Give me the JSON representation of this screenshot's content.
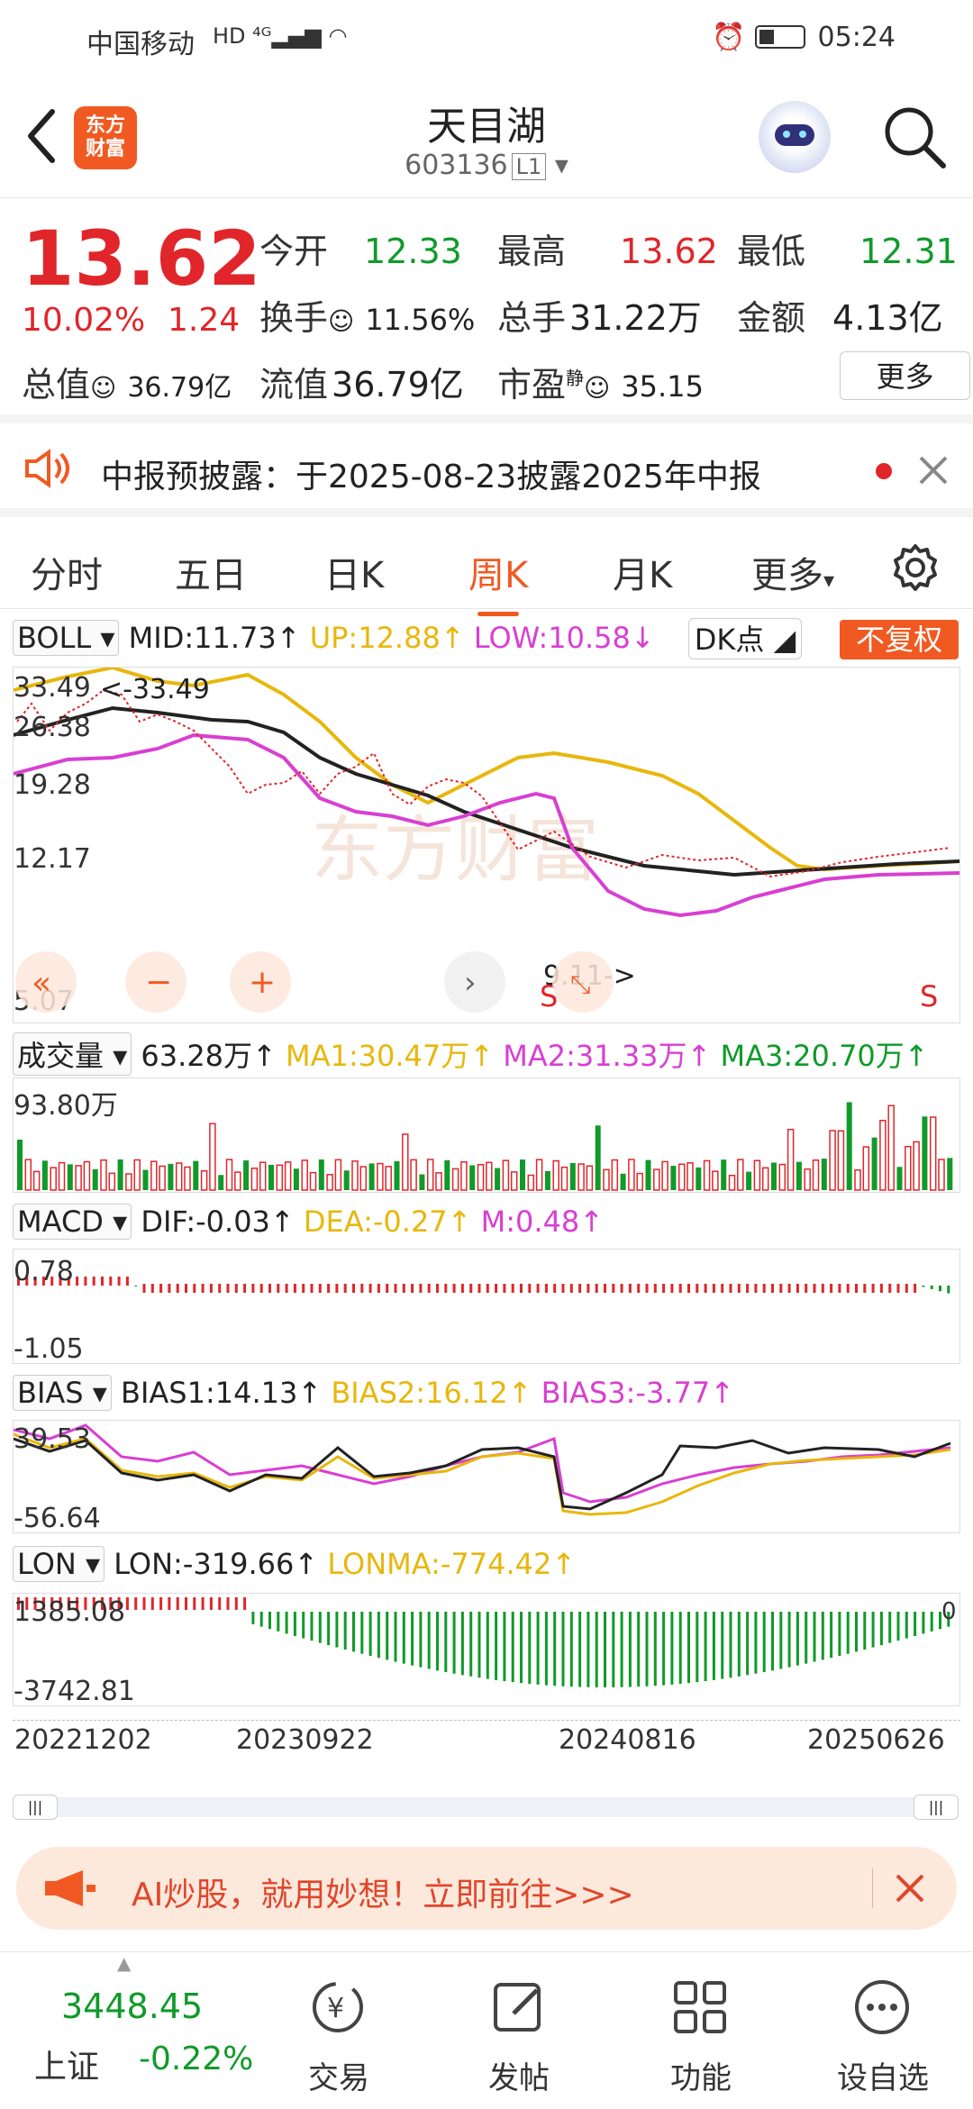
{
  "status": {
    "carrier": "中国移动",
    "time": "05:24"
  },
  "header": {
    "title": "天目湖",
    "code": "603136",
    "level": "L1",
    "logo_top": "东方",
    "logo_bottom": "财富"
  },
  "quote": {
    "price": "13.62",
    "pct": "10.02%",
    "chg": "1.24",
    "open_label": "今开",
    "open": "12.33",
    "high_label": "最高",
    "high": "13.62",
    "low_label": "最低",
    "low": "12.31",
    "turnover_label": "换手",
    "turnover": "11.56%",
    "volume_label": "总手",
    "volume": "31.22万",
    "amount_label": "金额",
    "amount": "4.13亿",
    "mktcap_label": "总值",
    "mktcap": "36.79亿",
    "float_label": "流值",
    "float": "36.79亿",
    "pe_label": "市盈",
    "pe_sup": "静",
    "pe": "35.15",
    "more": "更多"
  },
  "notice": {
    "text": "中报预披露：于2025-08-23披露2025年中报"
  },
  "tabs": [
    "分时",
    "五日",
    "日K",
    "周K",
    "月K",
    "更多"
  ],
  "boll": {
    "name": "BOLL",
    "mid": "MID:11.73↑",
    "up": "UP:12.88↑",
    "low": "LOW:10.58↓",
    "dk": "DK点",
    "fq": "不复权",
    "yticks": [
      "33.49",
      "26.38",
      "19.28",
      "12.17",
      "5.07"
    ],
    "max_note": "<-33.49",
    "min_note": "9.11->",
    "s_mark": "S"
  },
  "vol": {
    "name": "成交量",
    "val": "63.28万↑",
    "ma1": "MA1:30.47万↑",
    "ma2": "MA2:31.33万↑",
    "ma3": "MA3:20.70万↑",
    "ytick": "93.80万"
  },
  "macd": {
    "name": "MACD",
    "dif": "DIF:-0.03↑",
    "dea": "DEA:-0.27↑",
    "m": "M:0.48↑",
    "ytop": "0.78",
    "ybot": "-1.05"
  },
  "bias": {
    "name": "BIAS",
    "b1": "BIAS1:14.13↑",
    "b2": "BIAS2:16.12↑",
    "b3": "BIAS3:-3.77↑",
    "ytop": "39.53",
    "ybot": "-56.64"
  },
  "lon": {
    "name": "LON",
    "lon": "LON:-319.66↑",
    "lonma": "LONMA:-774.42↑",
    "ytop": "1385.08",
    "ybot": "-3742.81",
    "zero": "0"
  },
  "dates": [
    "20221202",
    "20230922",
    "20240816",
    "20250626"
  ],
  "ad": {
    "text": "AI炒股，就用妙想！立即前往>>>"
  },
  "bottom": {
    "index_val": "3448.45",
    "index_name": "上证",
    "index_chg": "-0.22%",
    "items": [
      "交易",
      "发帖",
      "功能",
      "设自选"
    ]
  },
  "colors": {
    "up": "#e0262a",
    "down": "#109a2a",
    "accent": "#f05a22",
    "yellow": "#e8b70c",
    "magenta": "#d83fd2"
  }
}
